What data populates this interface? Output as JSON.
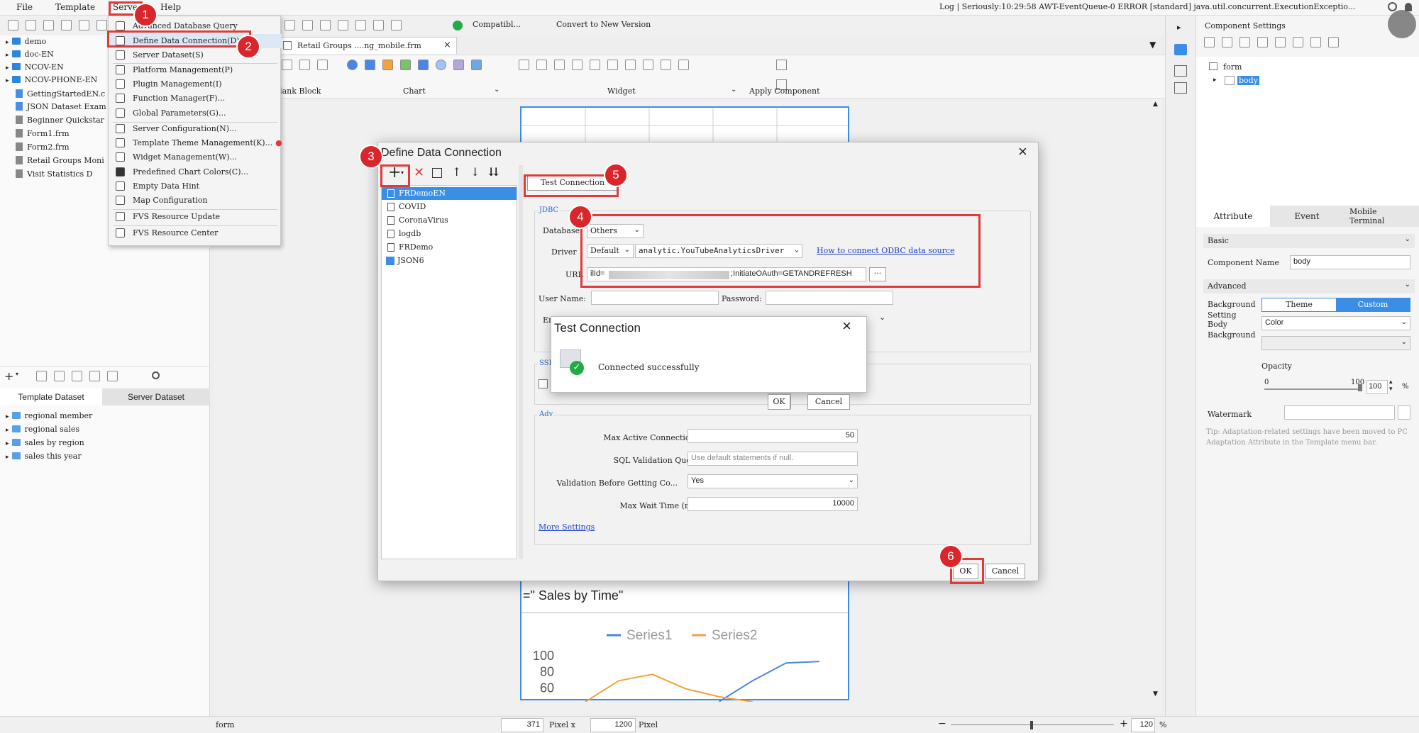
{
  "menubar": {
    "file": "File",
    "template": "Template",
    "server": "Server",
    "help": "Help",
    "log": "Log | Seriously:10:29:58 AWT-EventQueue-0 ERROR [standard] java.util.concurrent.ExecutionExceptio..."
  },
  "toolbar": {
    "compat": "Compatibl...",
    "convert": "Convert to New Version",
    "tab": "Retail Groups ....ng_mobile.frm",
    "groups": [
      "Blank Block",
      "Chart",
      "Widget",
      "Apply Component"
    ]
  },
  "left_tree": [
    "demo",
    "doc-EN",
    "NCOV-EN",
    "NCOV-PHONE-EN",
    "GettingStartedEN.c",
    "JSON Dataset Examp",
    "Beginner Quickstar",
    "Form1.frm",
    "Form2.frm",
    "Retail Groups Moni",
    "Visit Statistics D"
  ],
  "dataset": {
    "tab_template": "Template Dataset",
    "tab_server": "Server Dataset",
    "items": [
      "regional member",
      "regional sales",
      "sales by region",
      "sales this year"
    ]
  },
  "server_menu": [
    "Advanced Database Query",
    "Define Data Connection(D)",
    "Server Dataset(S)",
    "Platform Management(P)",
    "Plugin Management(I)",
    "Function Manager(F)...",
    "Global Parameters(G)...",
    "Server Configuration(N)...",
    "Template Theme Management(K)...",
    "Widget Management(W)...",
    "Predefined Chart Colors(C)...",
    "Empty Data Hint",
    "Map Configuration",
    "FVS Resource Update",
    "FVS Resource Center"
  ],
  "dialog": {
    "title": "Define Data Connection",
    "connections": [
      "FRDemoEN",
      "COVID",
      "CoronaVirus",
      "logdb",
      "FRDemo",
      "JSON6"
    ],
    "test_button": "Test Connection",
    "jdbc": "JDBC",
    "database_label": "Database",
    "database_value": "Others",
    "driver_label": "Driver",
    "driver_mode": "Default",
    "driver_value": "analytic.YouTubeAnalyticsDriver",
    "odbc_link": "How to connect ODBC data source",
    "url_label": "URL",
    "url_prefix": "ilId=",
    "url_suffix": ";InitiateOAuth=GETANDREFRESH",
    "url_more": "···",
    "username_label": "User Name:",
    "password_label": "Password:",
    "encoding_label": "En",
    "ssh": "SSH",
    "advanced": "Adv",
    "max_active_label": "Max Active Connections:",
    "max_active_value": "50",
    "sql_label": "SQL Validation Query:",
    "sql_placeholder": "Use default statements if null.",
    "validation_label": "Validation Before Getting Co...",
    "validation_value": "Yes",
    "max_wait_label": "Max Wait Time (ms):",
    "max_wait_value": "10000",
    "more_settings": "More Settings",
    "ok": "OK",
    "cancel": "Cancel"
  },
  "test_dialog": {
    "title": "Test Connection",
    "message": "Connected successfully",
    "ok": "OK",
    "cancel": "Cancel"
  },
  "canvas": {
    "chart_title": "=\"  Sales by Time\"",
    "legend": [
      "Series1",
      "Series2"
    ],
    "yticks": [
      "100",
      "80",
      "60"
    ]
  },
  "chart_data": {
    "type": "line",
    "title": "=\"  Sales by Time\"",
    "series": [
      {
        "name": "Series1",
        "values": [
          null,
          null,
          null,
          null,
          42,
          68,
          90,
          92
        ]
      },
      {
        "name": "Series2",
        "values": [
          40,
          68,
          76,
          58,
          48,
          40,
          null,
          null
        ]
      }
    ],
    "yticks": [
      100,
      80,
      60
    ],
    "color_series1": "#4a86e8",
    "color_series2": "#f2a33a"
  },
  "right_panel": {
    "title": "Component Settings",
    "tree_form": "form",
    "tree_body": "body",
    "tabs": [
      "Attribute",
      "Event",
      "Mobile Terminal"
    ],
    "basic": "Basic",
    "component_name_label": "Component Name",
    "component_name_value": "body",
    "advanced": "Advanced",
    "bg_label": "Background Setting",
    "theme": "Theme",
    "custom": "Custom",
    "body_bg_label": "Body Background",
    "body_bg_value": "Color",
    "opacity": "Opacity",
    "op_min": "0",
    "op_max": "100",
    "op_value": "100",
    "pct": "%",
    "watermark": "Watermark",
    "tip": "Tip: Adaptation-related settings have been moved to PC Adaptation Attribute in the Template menu bar."
  },
  "statusbar": {
    "form": "form",
    "width": "371",
    "pixel_x": "Pixel x",
    "height": "1200",
    "pixel": "Pixel",
    "zoom": "120",
    "pct": "%"
  },
  "badges": [
    "1",
    "2",
    "3",
    "4",
    "5",
    "6"
  ],
  "colors": {
    "accent": "#2a86e0",
    "highlight": "#e03b3b",
    "selected": "#3a8ee6"
  }
}
